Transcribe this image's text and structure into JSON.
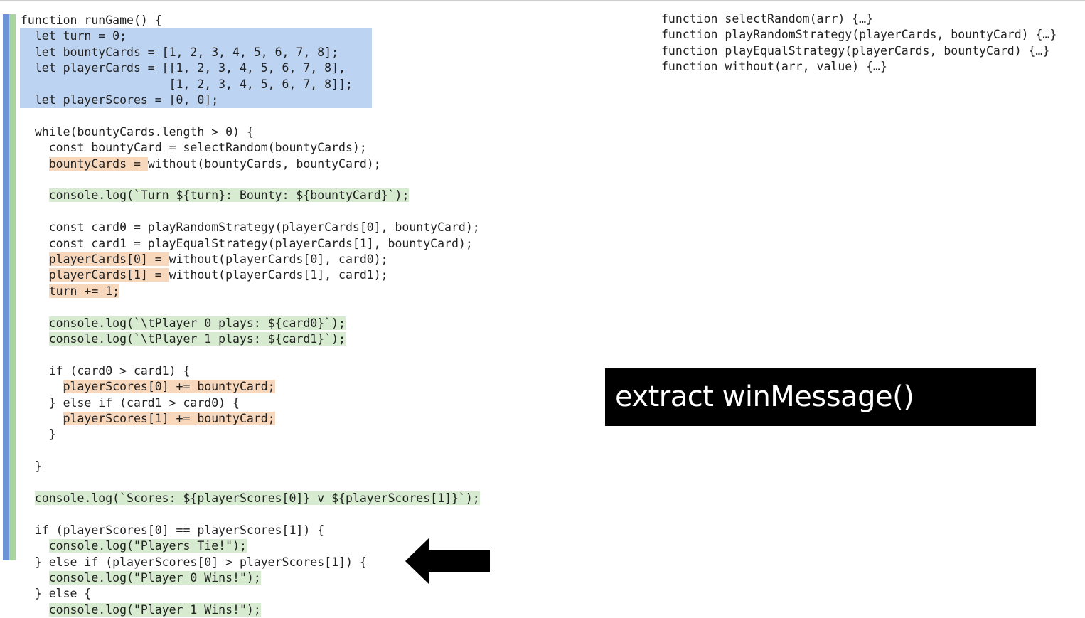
{
  "code_lines": [
    "function runGame() {",
    "  let turn = 0;",
    "  let bountyCards = [1, 2, 3, 4, 5, 6, 7, 8];",
    "  let playerCards = [[1, 2, 3, 4, 5, 6, 7, 8],",
    "                     [1, 2, 3, 4, 5, 6, 7, 8]];",
    "  let playerScores = [0, 0];",
    "",
    "  while(bountyCards.length > 0) {",
    "    const bountyCard = selectRandom(bountyCards);",
    "    bountyCards = without(bountyCards, bountyCard);",
    "",
    "    console.log(`Turn ${turn}: Bounty: ${bountyCard}`);",
    "",
    "    const card0 = playRandomStrategy(playerCards[0], bountyCard);",
    "    const card1 = playEqualStrategy(playerCards[1], bountyCard);",
    "    playerCards[0] = without(playerCards[0], card0);",
    "    playerCards[1] = without(playerCards[1], card1);",
    "    turn += 1;",
    "",
    "    console.log(`\\tPlayer 0 plays: ${card0}`);",
    "    console.log(`\\tPlayer 1 plays: ${card1}`);",
    "",
    "    if (card0 > card1) {",
    "      playerScores[0] += bountyCard;",
    "    } else if (card1 > card0) {",
    "      playerScores[1] += bountyCard;",
    "    }",
    "",
    "  }",
    "",
    "  console.log(`Scores: ${playerScores[0]} v ${playerScores[1]}`);",
    "",
    "  if (playerScores[0] == playerScores[1]) {",
    "    console.log(\"Players Tie!\");",
    "  } else if (playerScores[0] > playerScores[1]) {",
    "    console.log(\"Player 0 Wins!\");",
    "  } else {",
    "    console.log(\"Player 1 Wins!\");"
  ],
  "collapsed_functions": [
    "function selectRandom(arr) {…}",
    "function playRandomStrategy(playerCards, bountyCard) {…}",
    "function playEqualStrategy(playerCards, bountyCard) {…}",
    "function without(arr, value) {…}"
  ],
  "banner": {
    "text": "extract winMessage()"
  },
  "arrow_icon": "left-arrow-icon",
  "colors": {
    "blue_highlight": "#bcd3f2",
    "green_highlight": "#d6ebd0",
    "orange_highlight": "#f8d8bd",
    "blue_bar": "#6e93d6",
    "green_bar": "#a9d4a0"
  }
}
